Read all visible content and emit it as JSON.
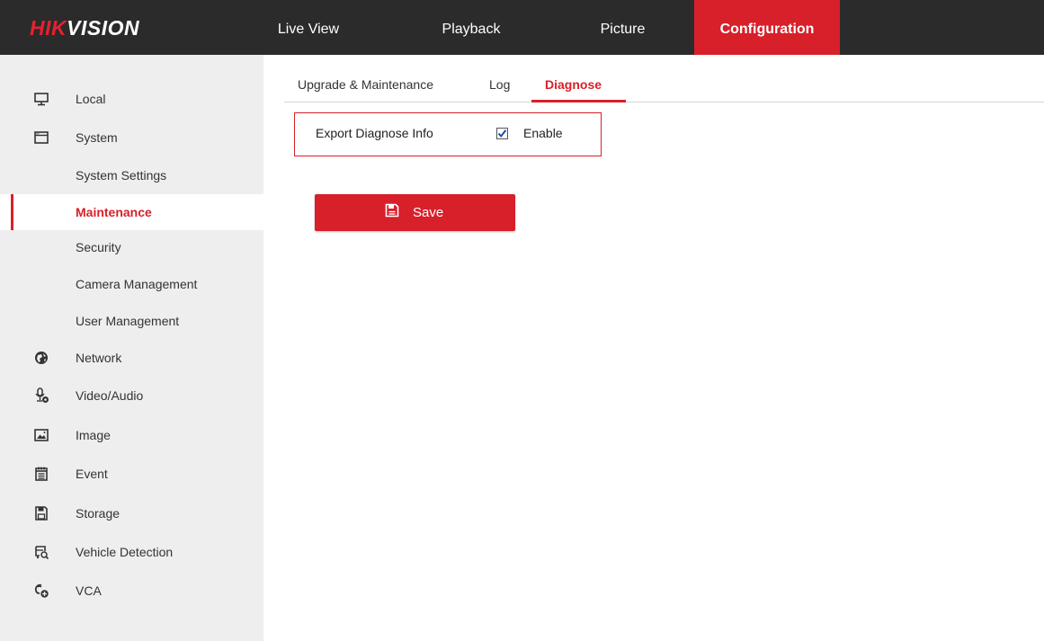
{
  "brand": {
    "logo_part1": "HIK",
    "logo_part2": "VISION"
  },
  "topnav": {
    "items": [
      {
        "label": "Live View"
      },
      {
        "label": "Playback"
      },
      {
        "label": "Picture"
      },
      {
        "label": "Configuration",
        "active": true
      }
    ]
  },
  "sidebar": {
    "items": [
      {
        "label": "Local",
        "icon": "monitor-icon"
      },
      {
        "label": "System",
        "icon": "system-window-icon"
      },
      {
        "label": "System Settings",
        "sub": true
      },
      {
        "label": "Maintenance",
        "sub": true,
        "active": true
      },
      {
        "label": "Security",
        "sub": true
      },
      {
        "label": "Camera Management",
        "sub": true
      },
      {
        "label": "User Management",
        "sub": true
      },
      {
        "label": "Network",
        "icon": "globe-icon"
      },
      {
        "label": "Video/Audio",
        "icon": "microphone-icon"
      },
      {
        "label": "Image",
        "icon": "image-icon"
      },
      {
        "label": "Event",
        "icon": "event-calendar-icon"
      },
      {
        "label": "Storage",
        "icon": "floppy-icon"
      },
      {
        "label": "Vehicle Detection",
        "icon": "vehicle-search-icon"
      },
      {
        "label": "VCA",
        "icon": "vca-icon"
      }
    ]
  },
  "tabs": [
    {
      "label": "Upgrade & Maintenance"
    },
    {
      "label": "Log"
    },
    {
      "label": "Diagnose",
      "active": true
    }
  ],
  "diagnose": {
    "label": "Export Diagnose Info",
    "checkbox_label": "Enable",
    "checked": true
  },
  "save_button": {
    "label": "Save",
    "icon": "floppy-icon"
  },
  "colors": {
    "accent": "#d7202a",
    "topbar": "#2b2b2b",
    "sidebar": "#eeeeee"
  }
}
